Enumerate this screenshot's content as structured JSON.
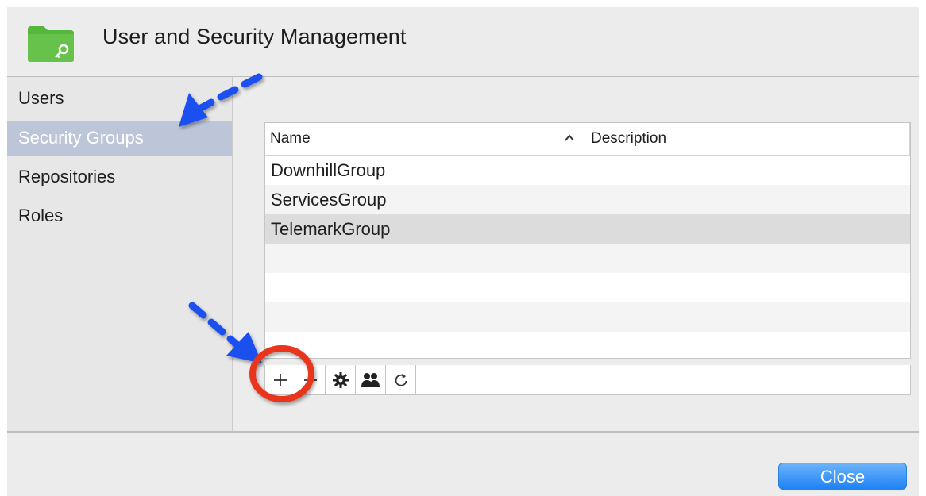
{
  "window": {
    "title": "User and Security Management",
    "app_icon": "folder-key-icon",
    "accent_color": "#1e83f5",
    "folder_color": "#55b73b"
  },
  "sidebar": {
    "items": [
      {
        "label": "Users",
        "selected": false
      },
      {
        "label": "Security Groups",
        "selected": true
      },
      {
        "label": "Repositories",
        "selected": false
      },
      {
        "label": "Roles",
        "selected": false
      }
    ]
  },
  "table": {
    "columns": [
      {
        "label": "Name",
        "sort": "ascending"
      },
      {
        "label": "Description"
      }
    ],
    "rows": [
      {
        "name": "DownhillGroup",
        "description": ""
      },
      {
        "name": "ServicesGroup",
        "description": ""
      },
      {
        "name": "TelemarkGroup",
        "description": "",
        "selected": true
      }
    ]
  },
  "toolbar": {
    "buttons": [
      {
        "icon": "plus-icon",
        "label": "+"
      },
      {
        "icon": "minus-icon",
        "label": "−"
      },
      {
        "icon": "gear-icon"
      },
      {
        "icon": "group-users-icon"
      },
      {
        "icon": "refresh-icon"
      }
    ]
  },
  "footer": {
    "close_label": "Close"
  },
  "annotations": {
    "arrow_color": "#1d4ff0",
    "circle_color": "#e8361f"
  }
}
